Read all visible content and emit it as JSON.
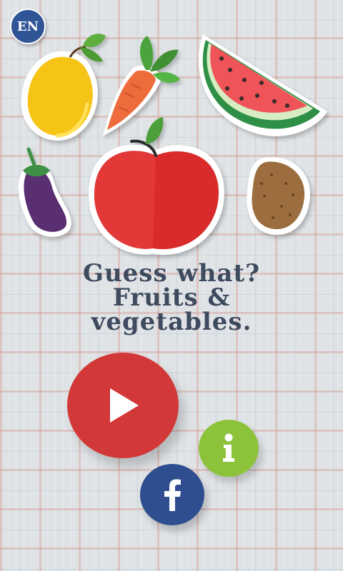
{
  "language_button": {
    "label": "EN"
  },
  "title": {
    "lines": [
      "Guess what?",
      "Fruits &",
      "vegetables."
    ]
  },
  "buttons": {
    "play": {
      "icon": "play-icon"
    },
    "info": {
      "icon": "info-icon"
    },
    "facebook": {
      "icon": "facebook-icon"
    }
  },
  "illustrations": [
    "lemon",
    "carrot",
    "watermelon",
    "eggplant",
    "apple",
    "potato"
  ],
  "colors": {
    "play": "#d33838",
    "info": "#8cc33a",
    "facebook": "#2f4e8f",
    "language": "#2f5596",
    "title_text": "#3e4a5e"
  }
}
